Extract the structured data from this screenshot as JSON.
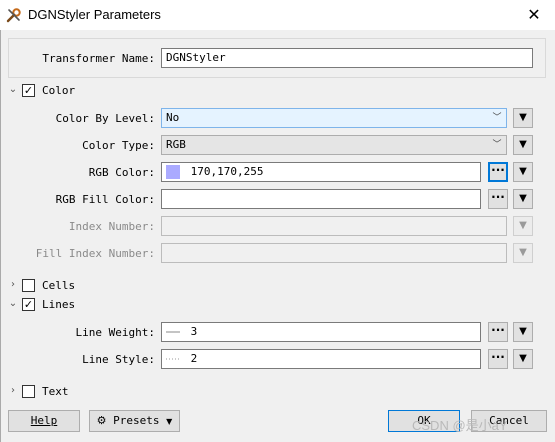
{
  "window": {
    "title": "DGNStyler Parameters",
    "close_glyph": "✕",
    "icon": "wrench-gear-icon"
  },
  "transformer": {
    "label": "Transformer Name:",
    "value": "DGNStyler"
  },
  "sections": {
    "color": {
      "label": "Color",
      "checked": true,
      "expanded": true
    },
    "cells": {
      "label": "Cells",
      "checked": false,
      "expanded": false
    },
    "lines": {
      "label": "Lines",
      "checked": true,
      "expanded": true
    },
    "text": {
      "label": "Text",
      "checked": false,
      "expanded": false
    }
  },
  "color": {
    "color_by_level": {
      "label": "Color By Level:",
      "value": "No"
    },
    "color_type": {
      "label": "Color Type:",
      "value": "RGB"
    },
    "rgb_color": {
      "label": "RGB Color:",
      "value": "170,170,255",
      "swatch": "#aaaaff"
    },
    "rgb_fill_color": {
      "label": "RGB Fill Color:",
      "value": ""
    },
    "index_number": {
      "label": "Index Number:",
      "value": ""
    },
    "fill_index_number": {
      "label": "Fill Index Number:",
      "value": ""
    }
  },
  "lines": {
    "line_weight": {
      "label": "Line Weight:",
      "value": "3"
    },
    "line_style": {
      "label": "Line Style:",
      "value": "2"
    }
  },
  "glyphs": {
    "checkmark": "✓",
    "dropdown": "﹀",
    "triangle": "▼",
    "more": "···",
    "chev_down": "﹀",
    "chev_right": "›"
  },
  "footer": {
    "help": "Help",
    "presets": "Presets",
    "ok": "OK",
    "cancel": "Cancel"
  },
  "watermark": "CSDN @是小aY"
}
